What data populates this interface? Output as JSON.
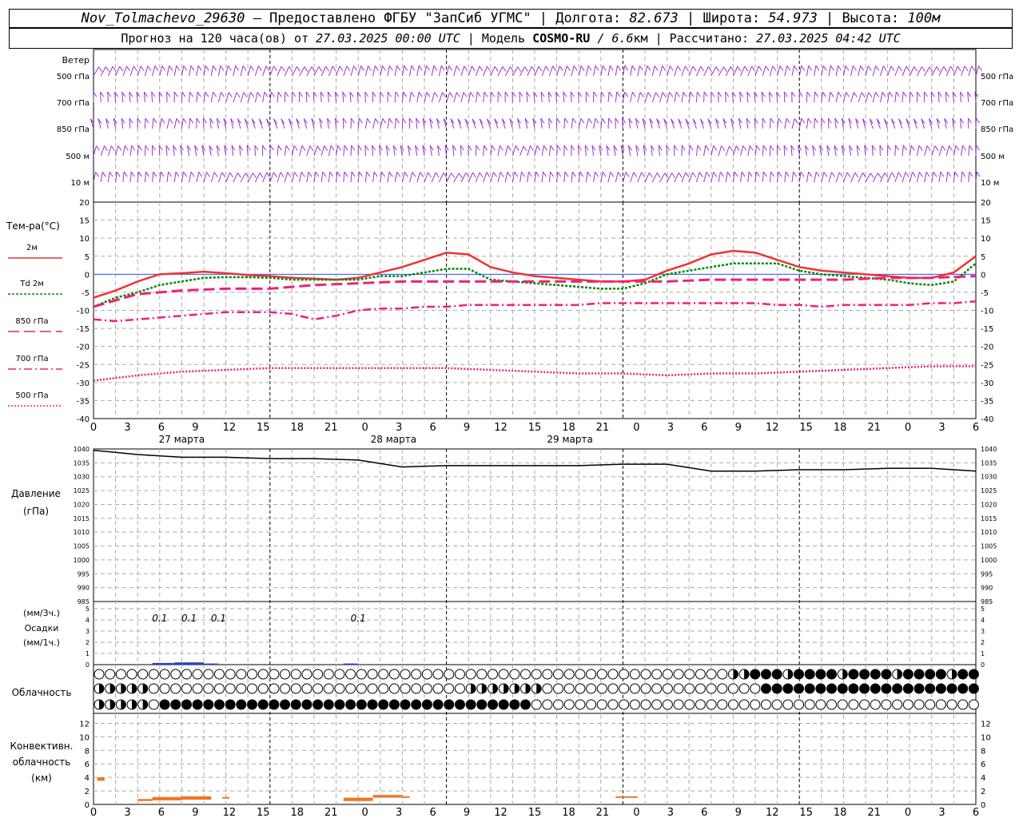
{
  "header": {
    "station": "Nov_Tolmachevo_29630",
    "provider": " – Предоставлено ФГБУ \"ЗапСиб УГМС\" | Долгота: ",
    "lon": "82.673",
    "lat_label": " | Широта: ",
    "lat": "54.973",
    "alt_label": " | Высота: ",
    "alt": "100м",
    "fc_label": "Прогноз на 120 часа(ов) от ",
    "fc_time": "27.03.2025 00:00 UTC",
    "model_label": " | Модель ",
    "model": "COSMO-RU",
    "res": " / 6.6",
    "res_unit": "км",
    "calc_label": " | Рассчитано: ",
    "calc_time": "27.03.2025 04:42 UTC"
  },
  "chart_data": {
    "x_ticks": [
      "0",
      "3",
      "6",
      "9",
      "12",
      "15",
      "18",
      "21",
      "0",
      "3",
      "6",
      "9",
      "12",
      "15",
      "18",
      "21",
      "0",
      "3",
      "6",
      "9",
      "12",
      "15",
      "18",
      "21",
      "0",
      "3",
      "6"
    ],
    "dates": [
      "27 марта",
      "28 марта",
      "29 марта"
    ],
    "wind": {
      "title": "Ветер",
      "levels": [
        "500 гПа",
        "700 гПа",
        "850 гПа",
        "500 м",
        "10  м"
      ],
      "color": "#9933cc"
    },
    "temperature": {
      "type": "line",
      "title": "Тем-ра(°С)",
      "ylim": [
        -40,
        20
      ],
      "ticks": [
        20,
        15,
        10,
        5,
        0,
        -5,
        -10,
        -15,
        -20,
        -25,
        -30,
        -35,
        -40
      ],
      "series": [
        {
          "name": "2м",
          "color": "#ee3333",
          "dash": "solid",
          "width": 2.5,
          "x": [
            0,
            3,
            6,
            9,
            12,
            15,
            18,
            21,
            24,
            27,
            30,
            33,
            36,
            39,
            42,
            45,
            48,
            51,
            54,
            57,
            60,
            63,
            66,
            69,
            72,
            75,
            78,
            81,
            84,
            87,
            90,
            93,
            96,
            99,
            102,
            105,
            108,
            111,
            114,
            117,
            120
          ],
          "y": [
            -6.5,
            -4.5,
            -2,
            0,
            0.3,
            0.7,
            0.3,
            -0.2,
            -0.5,
            -1,
            -1.2,
            -1.5,
            -1,
            0.5,
            2,
            4,
            6,
            5.5,
            2,
            0.5,
            -0.5,
            -1,
            -1.5,
            -2,
            -2,
            -1.5,
            1,
            3,
            5.5,
            6.5,
            6,
            4,
            2,
            1,
            0.5,
            0,
            -0.5,
            -1,
            -1,
            0.5,
            5
          ]
        },
        {
          "name": "Td  2м",
          "color": "#008800",
          "dash": "3,2",
          "width": 2.5,
          "x": [
            0,
            3,
            6,
            9,
            12,
            15,
            18,
            21,
            24,
            27,
            30,
            33,
            36,
            39,
            42,
            45,
            48,
            51,
            54,
            57,
            60,
            63,
            66,
            69,
            72,
            75,
            78,
            81,
            84,
            87,
            90,
            93,
            96,
            99,
            102,
            105,
            108,
            111,
            114,
            117,
            120
          ],
          "y": [
            -9,
            -6.5,
            -5,
            -3,
            -2,
            -1,
            -0.8,
            -0.8,
            -1,
            -1.5,
            -1.5,
            -1.5,
            -1.5,
            -0.5,
            -0.5,
            0.5,
            1.5,
            1.5,
            -1.5,
            -2,
            -2.5,
            -3,
            -3.5,
            -4,
            -4,
            -2.5,
            0,
            1,
            2,
            3,
            3,
            3,
            1,
            0,
            -0.5,
            -1,
            -1.5,
            -2.5,
            -3,
            -2,
            3
          ]
        },
        {
          "name": "850 гПа",
          "color": "#ee2277",
          "dash": "14,6",
          "width": 3,
          "x": [
            0,
            6,
            12,
            18,
            24,
            30,
            36,
            42,
            48,
            54,
            60,
            66,
            72,
            78,
            84,
            90,
            96,
            102,
            108,
            114,
            120
          ],
          "y": [
            -9,
            -5.5,
            -4.5,
            -4,
            -4,
            -3,
            -2.5,
            -2,
            -2,
            -2,
            -2,
            -2,
            -2,
            -2,
            -1.5,
            -1.5,
            -1.5,
            -1.5,
            -1,
            -1,
            -0.5
          ]
        },
        {
          "name": "700 гПа",
          "color": "#ee2277",
          "dash": "10,4,2,4",
          "width": 2.5,
          "x": [
            0,
            3,
            6,
            9,
            12,
            15,
            18,
            21,
            24,
            27,
            30,
            33,
            36,
            39,
            42,
            45,
            48,
            51,
            54,
            57,
            60,
            63,
            66,
            69,
            72,
            75,
            78,
            81,
            84,
            87,
            90,
            93,
            96,
            99,
            102,
            105,
            108,
            111,
            114,
            117,
            120
          ],
          "y": [
            -12.5,
            -13,
            -12.5,
            -12,
            -11.5,
            -11,
            -10.5,
            -10.5,
            -10.5,
            -11,
            -12.5,
            -11.5,
            -10,
            -9.5,
            -9.5,
            -9,
            -9,
            -8.5,
            -8.5,
            -8.5,
            -8.5,
            -8.5,
            -8.5,
            -8,
            -8,
            -8,
            -8,
            -8,
            -8,
            -8,
            -8,
            -8.5,
            -8.5,
            -9,
            -8.5,
            -8.5,
            -8.5,
            -8.5,
            -8,
            -8,
            -7.5
          ]
        },
        {
          "name": "500 гПа",
          "color": "#ee2277",
          "dash": "2,2",
          "width": 2.5,
          "x": [
            0,
            6,
            12,
            18,
            24,
            30,
            36,
            42,
            48,
            54,
            60,
            66,
            72,
            78,
            84,
            90,
            96,
            102,
            108,
            114,
            120
          ],
          "y": [
            -29.5,
            -28,
            -27,
            -26.5,
            -26,
            -26,
            -26,
            -26,
            -26,
            -26.5,
            -27,
            -27.5,
            -27.5,
            -28,
            -27.5,
            -27.5,
            -27,
            -26.5,
            -26,
            -25.5,
            -25.5
          ]
        }
      ]
    },
    "pressure": {
      "type": "line",
      "title": "Давление",
      "unit": "(гПа)",
      "ylim": [
        985,
        1040
      ],
      "ticks": [
        1040,
        1035,
        1030,
        1025,
        1020,
        1015,
        1010,
        1005,
        1000,
        995,
        990,
        985
      ],
      "x": [
        0,
        6,
        12,
        18,
        24,
        30,
        36,
        42,
        48,
        54,
        60,
        66,
        72,
        78,
        84,
        90,
        96,
        102,
        108,
        114,
        120
      ],
      "y": [
        1039.5,
        1038,
        1037,
        1037,
        1036.5,
        1036.5,
        1036,
        1033.5,
        1034,
        1034,
        1034,
        1034,
        1034.5,
        1034.5,
        1032,
        1032,
        1032.5,
        1032.5,
        1033,
        1033,
        1032
      ]
    },
    "precip": {
      "type": "bar",
      "label_3h": "(мм/3ч.)",
      "title": "Осадки",
      "label_1h": "(мм/1ч.)",
      "ylim": [
        0,
        5
      ],
      "ticks": [
        5,
        4,
        3,
        2,
        1,
        0
      ],
      "annotations": [
        {
          "x": 9,
          "text": "0.1"
        },
        {
          "x": 13,
          "text": "0.1"
        },
        {
          "x": 17,
          "text": "0.1"
        },
        {
          "x": 36,
          "text": "0.1"
        }
      ],
      "bars": [
        {
          "x0": 8,
          "x1": 11,
          "v": 0.15
        },
        {
          "x0": 11,
          "x1": 15,
          "v": 0.2
        },
        {
          "x0": 15,
          "x1": 17,
          "v": 0.1
        },
        {
          "x0": 34,
          "x1": 36,
          "v": 0.1
        }
      ]
    },
    "clouds": {
      "title": "Облачность",
      "rows": [
        "hhhhhhhhhhhhhhhhhhhhhhhhhhhhhhhhhhhhhhhhhhhhhhhhhhhhhhhhhhhhhhhhhhhhhhhhhhhhhhhhhhhhhhhhhhhhhhhhhhhhhhhhhhhhhhhhhhhhhhhhhhhhhhhhhhhhhhhh",
        "hhhhhhhhhhhhhhhhhhhhhhhhhhhhhhhhhhhhhhhhhhhhhhhhhhhhhhhhhhhhhhhhhhhhhhhhhhhhhhhhhhhhhhhhhhhhhhhhhhhhhhhhhhhhhhhhhhhhhhhhhhhhhhhhhhhhhhhh",
        "hhhhhhhhhhhhhhhhhhhhhhhhhhhhhhhhhhhhhhhhhhhhhhhhhhhhhhhhhhhhhhhhhhhhhhhhhhhhhhhhhhhhhhhhhhhhhhhhhhhhhhhhhhhhhhhhhhhhhhhhhhhhhhhhhhhhhhhh"
      ]
    },
    "convective": {
      "type": "bar",
      "title1": "Конвективн.",
      "title2": "облачность",
      "unit": "(км)",
      "ylim": [
        0,
        13
      ],
      "ticks": [
        12,
        10,
        8,
        6,
        4,
        2,
        0
      ],
      "color": "#ee7722",
      "segments": [
        {
          "x0": 0.5,
          "x1": 1.5,
          "lo": 3.5,
          "hi": 4.0
        },
        {
          "x0": 6,
          "x1": 8,
          "lo": 0.5,
          "hi": 0.8
        },
        {
          "x0": 8,
          "x1": 12,
          "lo": 0.6,
          "hi": 1.1
        },
        {
          "x0": 12,
          "x1": 16,
          "lo": 0.7,
          "hi": 1.2
        },
        {
          "x0": 17.5,
          "x1": 18.5,
          "lo": 0.9,
          "hi": 1.1
        },
        {
          "x0": 34,
          "x1": 38,
          "lo": 0.5,
          "hi": 1.0
        },
        {
          "x0": 38,
          "x1": 42,
          "lo": 1.0,
          "hi": 1.4
        },
        {
          "x0": 42,
          "x1": 43,
          "lo": 1.0,
          "hi": 1.2
        },
        {
          "x0": 71,
          "x1": 74,
          "lo": 1.0,
          "hi": 1.2
        }
      ]
    }
  }
}
